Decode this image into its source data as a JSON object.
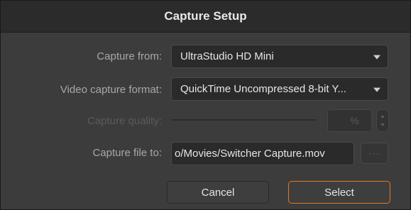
{
  "dialog": {
    "title": "Capture Setup"
  },
  "capture_from": {
    "label": "Capture from:",
    "value": "UltraStudio HD Mini"
  },
  "video_format": {
    "label": "Video capture format:",
    "value": "QuickTime Uncompressed 8-bit Y..."
  },
  "quality": {
    "label": "Capture quality:",
    "value": "",
    "unit": "%"
  },
  "capture_file": {
    "label": "Capture file to:",
    "value": "o/Movies/Switcher Capture.mov",
    "browse_label": "···"
  },
  "buttons": {
    "cancel": "Cancel",
    "select": "Select"
  },
  "colors": {
    "accent": "#e07a1f",
    "background": "#3c3c3c"
  }
}
